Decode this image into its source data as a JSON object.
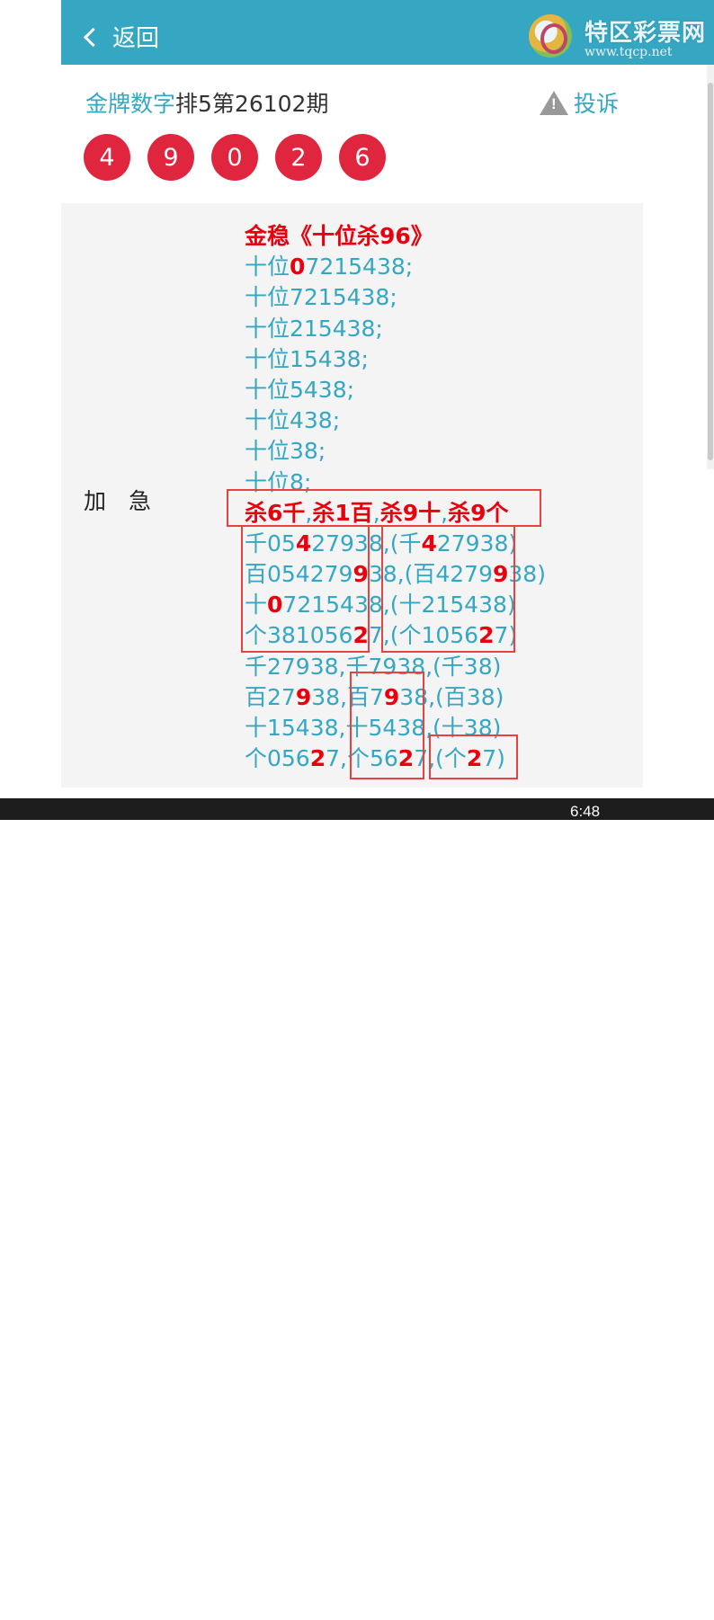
{
  "header": {
    "back_label": "返回",
    "logo_name": "特区彩票网",
    "logo_url": "www.tqcp.net"
  },
  "title": {
    "brand": "金牌数字",
    "text": "排5第26102期"
  },
  "complain_label": "投诉",
  "balls": [
    "4",
    "9",
    "0",
    "2",
    "6"
  ],
  "panel": {
    "label": "加　急",
    "lines": [
      [
        {
          "t": "金稳《十位杀96》",
          "r": true
        }
      ],
      [
        {
          "t": "十位"
        },
        {
          "t": "0",
          "r": true
        },
        {
          "t": "7215438;"
        }
      ],
      [
        {
          "t": "十位7215438;"
        }
      ],
      [
        {
          "t": "十位215438;"
        }
      ],
      [
        {
          "t": "十位15438;"
        }
      ],
      [
        {
          "t": "十位5438;"
        }
      ],
      [
        {
          "t": "十位438;"
        }
      ],
      [
        {
          "t": "十位38;"
        }
      ],
      [
        {
          "t": "十位8;"
        }
      ],
      [
        {
          "t": "杀6千",
          "r": true
        },
        {
          "t": ","
        },
        {
          "t": "杀1百",
          "r": true
        },
        {
          "t": ","
        },
        {
          "t": "杀9十",
          "r": true
        },
        {
          "t": ","
        },
        {
          "t": "杀9个",
          "r": true
        }
      ],
      [
        {
          "t": "千05"
        },
        {
          "t": "4",
          "r": true
        },
        {
          "t": "27938,(千"
        },
        {
          "t": "4",
          "r": true
        },
        {
          "t": "27938)"
        }
      ],
      [
        {
          "t": "百054279"
        },
        {
          "t": "9",
          "r": true
        },
        {
          "t": "38,(百4279"
        },
        {
          "t": "9",
          "r": true
        },
        {
          "t": "38)"
        }
      ],
      [
        {
          "t": "十"
        },
        {
          "t": "0",
          "r": true
        },
        {
          "t": "7215438,(十215438)"
        }
      ],
      [
        {
          "t": "个381056"
        },
        {
          "t": "2",
          "r": true
        },
        {
          "t": "7,(个1056"
        },
        {
          "t": "2",
          "r": true
        },
        {
          "t": "7)"
        }
      ],
      [
        {
          "t": "千27938,千7938,(千38)"
        }
      ],
      [
        {
          "t": "百27"
        },
        {
          "t": "9",
          "r": true
        },
        {
          "t": "38,百7"
        },
        {
          "t": "9",
          "r": true
        },
        {
          "t": "38,(百38)"
        }
      ],
      [
        {
          "t": "十15438,十5438,(十38)"
        }
      ],
      [
        {
          "t": "个056"
        },
        {
          "t": "2",
          "r": true
        },
        {
          "t": "7,个56"
        },
        {
          "t": "2",
          "r": true
        },
        {
          "t": "7,(个"
        },
        {
          "t": "2",
          "r": true
        },
        {
          "t": "7)"
        }
      ]
    ]
  },
  "taskbar": {
    "time": "6:48"
  },
  "colors": {
    "accent": "#35a7c3",
    "ball": "#e0253e",
    "highlight": "#e8000d",
    "box": "#e6423f"
  }
}
